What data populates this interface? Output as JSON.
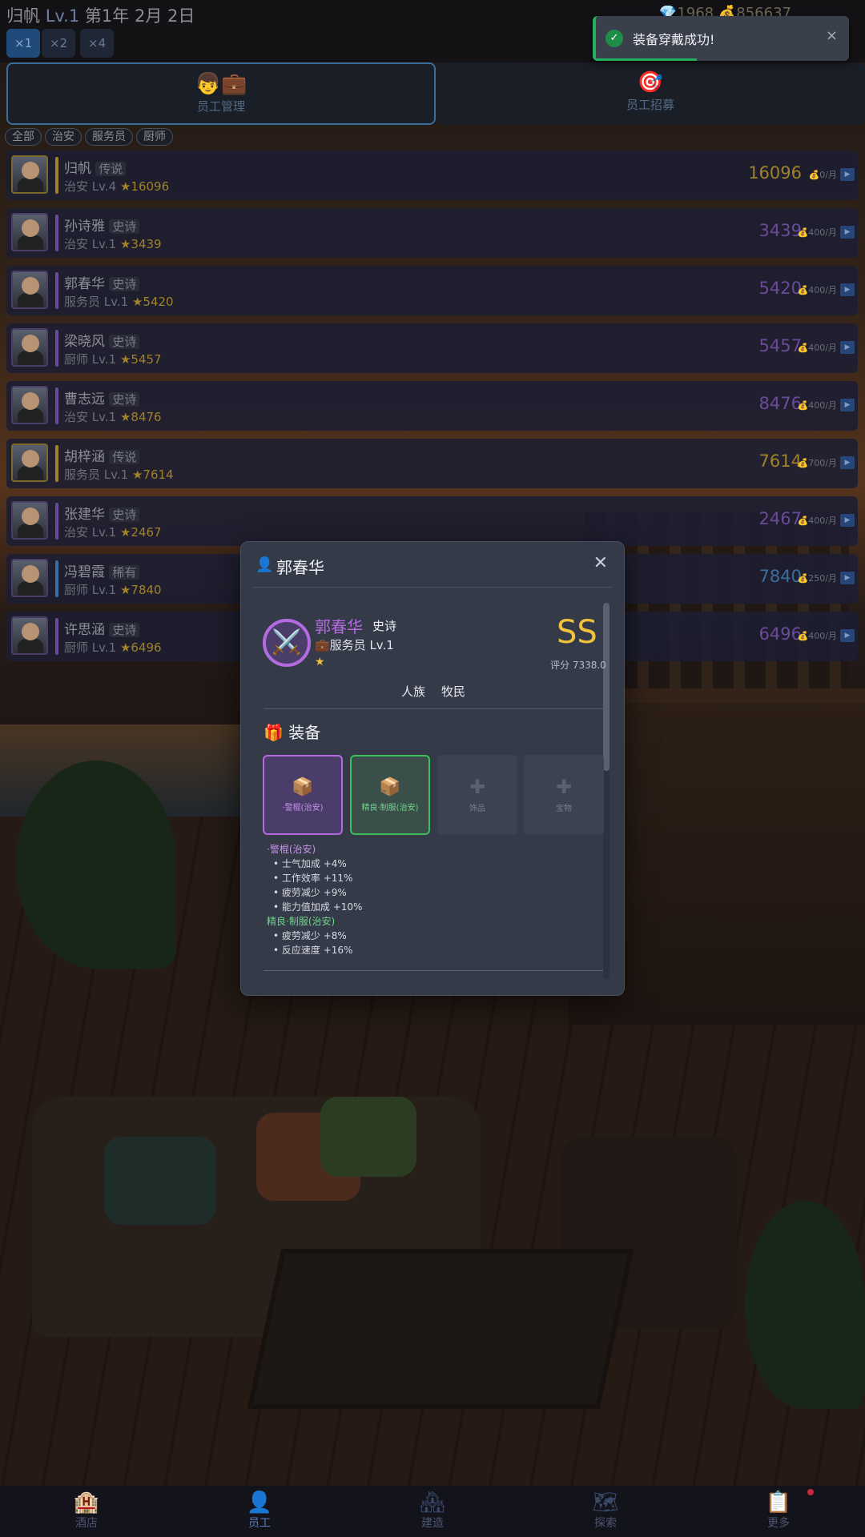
{
  "header": {
    "player_name": "归帆",
    "player_level": "Lv.1",
    "date": "第1年 2月 2日",
    "gems": "1968",
    "gold": "856637",
    "speed_options": [
      "×1",
      "×2",
      "×4"
    ],
    "active_speed": "×1"
  },
  "tabs": [
    {
      "label": "员工管理",
      "icon": "staff-management-icon",
      "glyph": "👦💼",
      "active": true
    },
    {
      "label": "员工招募",
      "icon": "recruit-target-icon",
      "glyph": "🎯",
      "active": false
    }
  ],
  "filters": [
    "全部",
    "治安",
    "服务员",
    "厨师"
  ],
  "staff": [
    {
      "name": "归帆",
      "rarity": "传说",
      "job": "治安",
      "level": "Lv.4",
      "stars": "★16096",
      "score": "16096",
      "salary": "💰0/月",
      "color": "#a08228"
    },
    {
      "name": "孙诗雅",
      "rarity": "史诗",
      "job": "治安",
      "level": "Lv.1",
      "stars": "★3439",
      "score": "3439",
      "salary": "💰400/月",
      "color": "#6a4a9a"
    },
    {
      "name": "郭春华",
      "rarity": "史诗",
      "job": "服务员",
      "level": "Lv.1",
      "stars": "★5420",
      "score": "5420",
      "salary": "💰400/月",
      "color": "#6a4a9a"
    },
    {
      "name": "梁晓风",
      "rarity": "史诗",
      "job": "厨师",
      "level": "Lv.1",
      "stars": "★5457",
      "score": "5457",
      "salary": "💰400/月",
      "color": "#6a4a9a"
    },
    {
      "name": "曹志远",
      "rarity": "史诗",
      "job": "治安",
      "level": "Lv.1",
      "stars": "★8476",
      "score": "8476",
      "salary": "💰400/月",
      "color": "#6a4a9a"
    },
    {
      "name": "胡梓涵",
      "rarity": "传说",
      "job": "服务员",
      "level": "Lv.1",
      "stars": "★7614",
      "score": "7614",
      "salary": "💰700/月",
      "color": "#a08228"
    },
    {
      "name": "张建华",
      "rarity": "史诗",
      "job": "治安",
      "level": "Lv.1",
      "stars": "★2467",
      "score": "2467",
      "salary": "💰400/月",
      "color": "#6a4a9a"
    },
    {
      "name": "冯碧霞",
      "rarity": "稀有",
      "job": "厨师",
      "level": "Lv.1",
      "stars": "★7840",
      "score": "7840",
      "salary": "💰250/月",
      "color": "#3a6ea0"
    },
    {
      "name": "许思涵",
      "rarity": "史诗",
      "job": "厨师",
      "level": "Lv.1",
      "stars": "★6496",
      "score": "6496",
      "salary": "💰400/月",
      "color": "#6a4a9a"
    }
  ],
  "toast": {
    "message": "装备穿戴成功!",
    "close": "×",
    "progress": 0.4
  },
  "modal": {
    "title": "郭春华",
    "close": "✕",
    "name": "郭春华",
    "rarity": "史诗",
    "job": "💼服务员 Lv.1",
    "stars": "★",
    "grade": "SS",
    "rating": "评分 7338.0",
    "tags": [
      "人族",
      "牧民"
    ],
    "equip_title": "装备",
    "slots": [
      {
        "label": "·警棍(治安)",
        "icon": "box-icon",
        "glyph": "📦",
        "state": "purple"
      },
      {
        "label": "精良·制服(治安)",
        "icon": "box-icon",
        "glyph": "📦",
        "state": "green"
      },
      {
        "label": "饰品",
        "icon": "plus-icon",
        "glyph": "✚",
        "state": "empty"
      },
      {
        "label": "宝物",
        "icon": "plus-icon",
        "glyph": "✚",
        "state": "empty"
      }
    ],
    "equip_details": [
      {
        "name": "·警棍(治安)",
        "color": "#c692ea",
        "stats": [
          "• 士气加成 +4%",
          "• 工作效率 +11%",
          "• 疲劳减少 +9%",
          "• 能力值加成 +10%"
        ]
      },
      {
        "name": "精良·制服(治安)",
        "color": "#6fd58a",
        "stats": [
          "• 疲劳减少 +8%",
          "• 反应速度 +16%"
        ]
      }
    ]
  },
  "nav": [
    {
      "label": "酒店",
      "icon": "hotel-icon",
      "glyph": "🏨",
      "active": false
    },
    {
      "label": "员工",
      "icon": "person-icon",
      "glyph": "👤",
      "active": true
    },
    {
      "label": "建造",
      "icon": "build-icon",
      "glyph": "🏘",
      "active": false
    },
    {
      "label": "探索",
      "icon": "map-icon",
      "glyph": "🗺",
      "active": false
    },
    {
      "label": "更多",
      "icon": "clipboard-icon",
      "glyph": "📋",
      "active": false
    }
  ]
}
